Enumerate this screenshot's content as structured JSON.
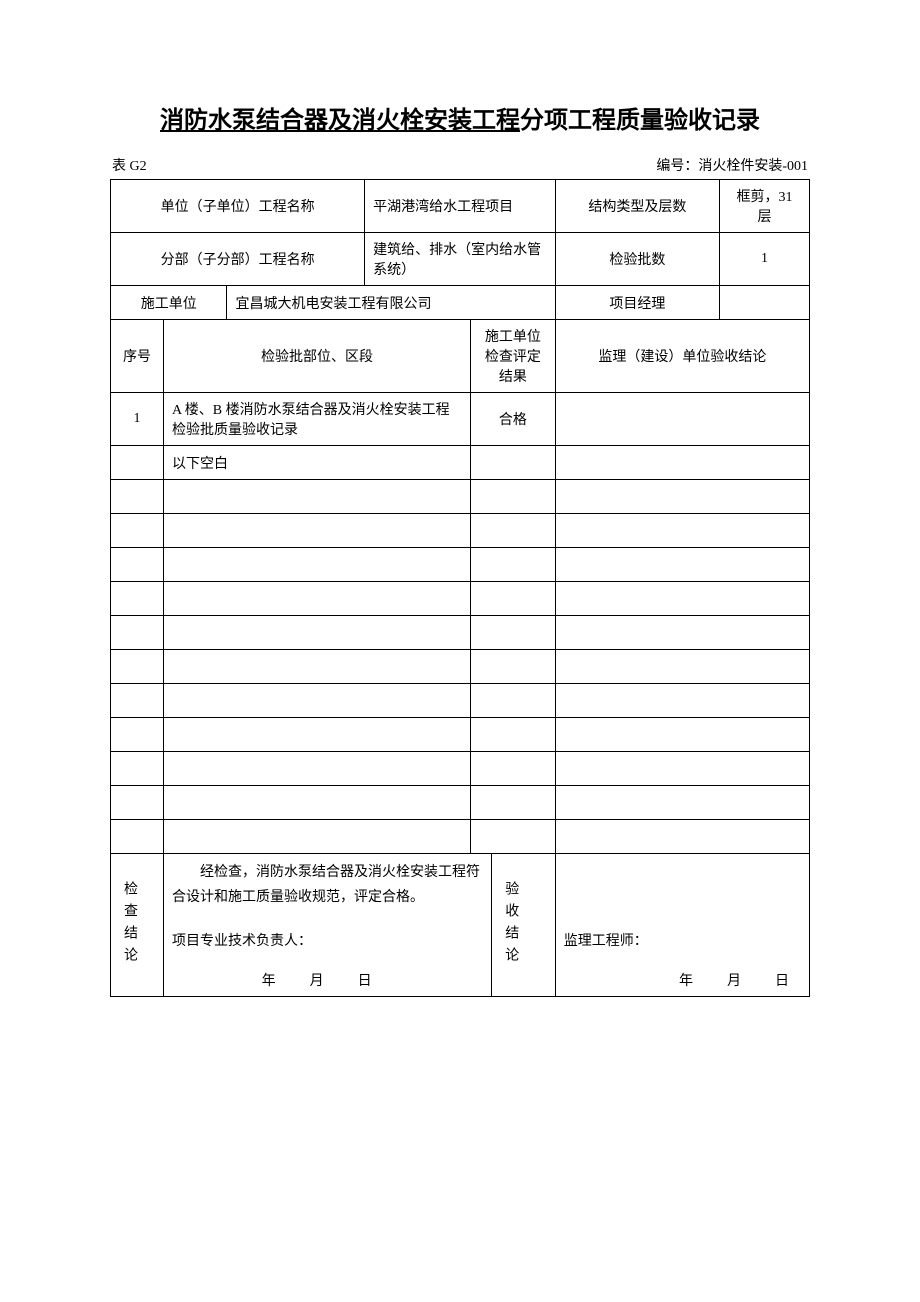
{
  "title": {
    "underlined": "消防水泵结合器及消火栓安装工程",
    "plain": "分项工程质量验收记录"
  },
  "meta": {
    "form_code": "表 G2",
    "serial_label": "编号：",
    "serial_value": "消火栓件安装-001"
  },
  "header": {
    "unit_project_label": "单位（子单位）工程名称",
    "unit_project_value": "平湖港湾给水工程项目",
    "structure_type_label": "结构类型及层数",
    "structure_type_value": "框剪，31 层",
    "sub_project_label": "分部（子分部）工程名称",
    "sub_project_value": "建筑给、排水（室内给水管系统）",
    "inspection_batch_label": "检验批数",
    "inspection_batch_value": "1",
    "construction_unit_label": "施工单位",
    "construction_unit_value": "宜昌城大机电安装工程有限公司",
    "project_manager_label": "项目经理",
    "project_manager_value": ""
  },
  "table_headers": {
    "seq": "序号",
    "section": "检验批部位、区段",
    "construction_result": "施工单位检查评定结果",
    "supervisor_result": "监理（建设）单位验收结论"
  },
  "rows": [
    {
      "seq": "1",
      "section": "A 楼、B 楼消防水泵结合器及消火栓安装工程检验批质量验收记录",
      "construction_result": "合格",
      "supervisor_result": ""
    },
    {
      "seq": "",
      "section": "以下空白",
      "construction_result": "",
      "supervisor_result": ""
    },
    {
      "seq": "",
      "section": "",
      "construction_result": "",
      "supervisor_result": ""
    },
    {
      "seq": "",
      "section": "",
      "construction_result": "",
      "supervisor_result": ""
    },
    {
      "seq": "",
      "section": "",
      "construction_result": "",
      "supervisor_result": ""
    },
    {
      "seq": "",
      "section": "",
      "construction_result": "",
      "supervisor_result": ""
    },
    {
      "seq": "",
      "section": "",
      "construction_result": "",
      "supervisor_result": ""
    },
    {
      "seq": "",
      "section": "",
      "construction_result": "",
      "supervisor_result": ""
    },
    {
      "seq": "",
      "section": "",
      "construction_result": "",
      "supervisor_result": ""
    },
    {
      "seq": "",
      "section": "",
      "construction_result": "",
      "supervisor_result": ""
    },
    {
      "seq": "",
      "section": "",
      "construction_result": "",
      "supervisor_result": ""
    },
    {
      "seq": "",
      "section": "",
      "construction_result": "",
      "supervisor_result": ""
    },
    {
      "seq": "",
      "section": "",
      "construction_result": "",
      "supervisor_result": ""
    }
  ],
  "conclusion": {
    "check_label": "检查结论",
    "check_text": "经检查，消防水泵结合器及消火栓安装工程符合设计和施工质量验收规范，评定合格。",
    "check_signer_label": "项目专业技术负责人：",
    "accept_label": "验收结论",
    "accept_text": "",
    "accept_signer_label": "监理工程师：",
    "date_template": "年　　月　　日"
  }
}
